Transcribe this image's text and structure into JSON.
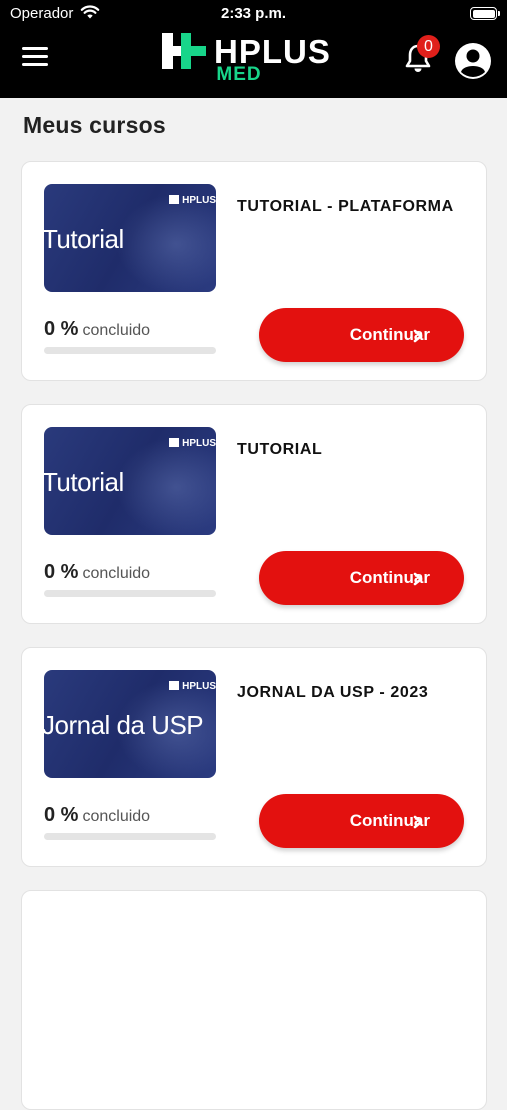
{
  "status_bar": {
    "carrier": "Operador",
    "time": "2:33 p.m."
  },
  "header": {
    "brand": "HPLUS",
    "sub": "MED",
    "notification_count": "0",
    "accent_color": "#18d58a"
  },
  "section_title": "Meus cursos",
  "courses": [
    {
      "title": "TUTORIAL - PLATAFORMA",
      "thumb_text": "Tutorial",
      "progress": "0 %",
      "progress_value": 0,
      "progress_label": "concluido",
      "button_label": "Continuar"
    },
    {
      "title": "TUTORIAL",
      "thumb_text": "Tutorial",
      "progress": "0 %",
      "progress_value": 0,
      "progress_label": "concluido",
      "button_label": "Continuar"
    },
    {
      "title": "JORNAL DA USP - 2023",
      "thumb_text": "Jornal da USP",
      "progress": "0 %",
      "progress_value": 0,
      "progress_label": "concluido",
      "button_label": "Continuar"
    }
  ],
  "colors": {
    "primary_button": "#e3110f",
    "badge": "#e0201b"
  }
}
